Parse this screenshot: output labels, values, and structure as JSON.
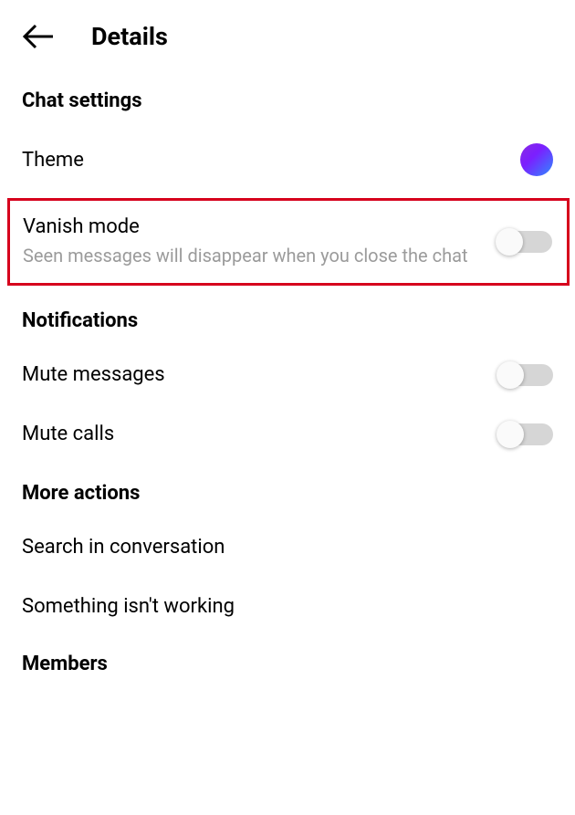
{
  "header": {
    "title": "Details"
  },
  "sections": {
    "chatSettings": {
      "header": "Chat settings",
      "theme": {
        "label": "Theme"
      },
      "vanishMode": {
        "label": "Vanish mode",
        "sublabel": "Seen messages will disappear when you close the chat",
        "enabled": false
      }
    },
    "notifications": {
      "header": "Notifications",
      "muteMessages": {
        "label": "Mute messages",
        "enabled": false
      },
      "muteCalls": {
        "label": "Mute calls",
        "enabled": false
      }
    },
    "moreActions": {
      "header": "More actions",
      "search": {
        "label": "Search in conversation"
      },
      "report": {
        "label": "Something isn't working"
      }
    },
    "members": {
      "header": "Members"
    }
  }
}
